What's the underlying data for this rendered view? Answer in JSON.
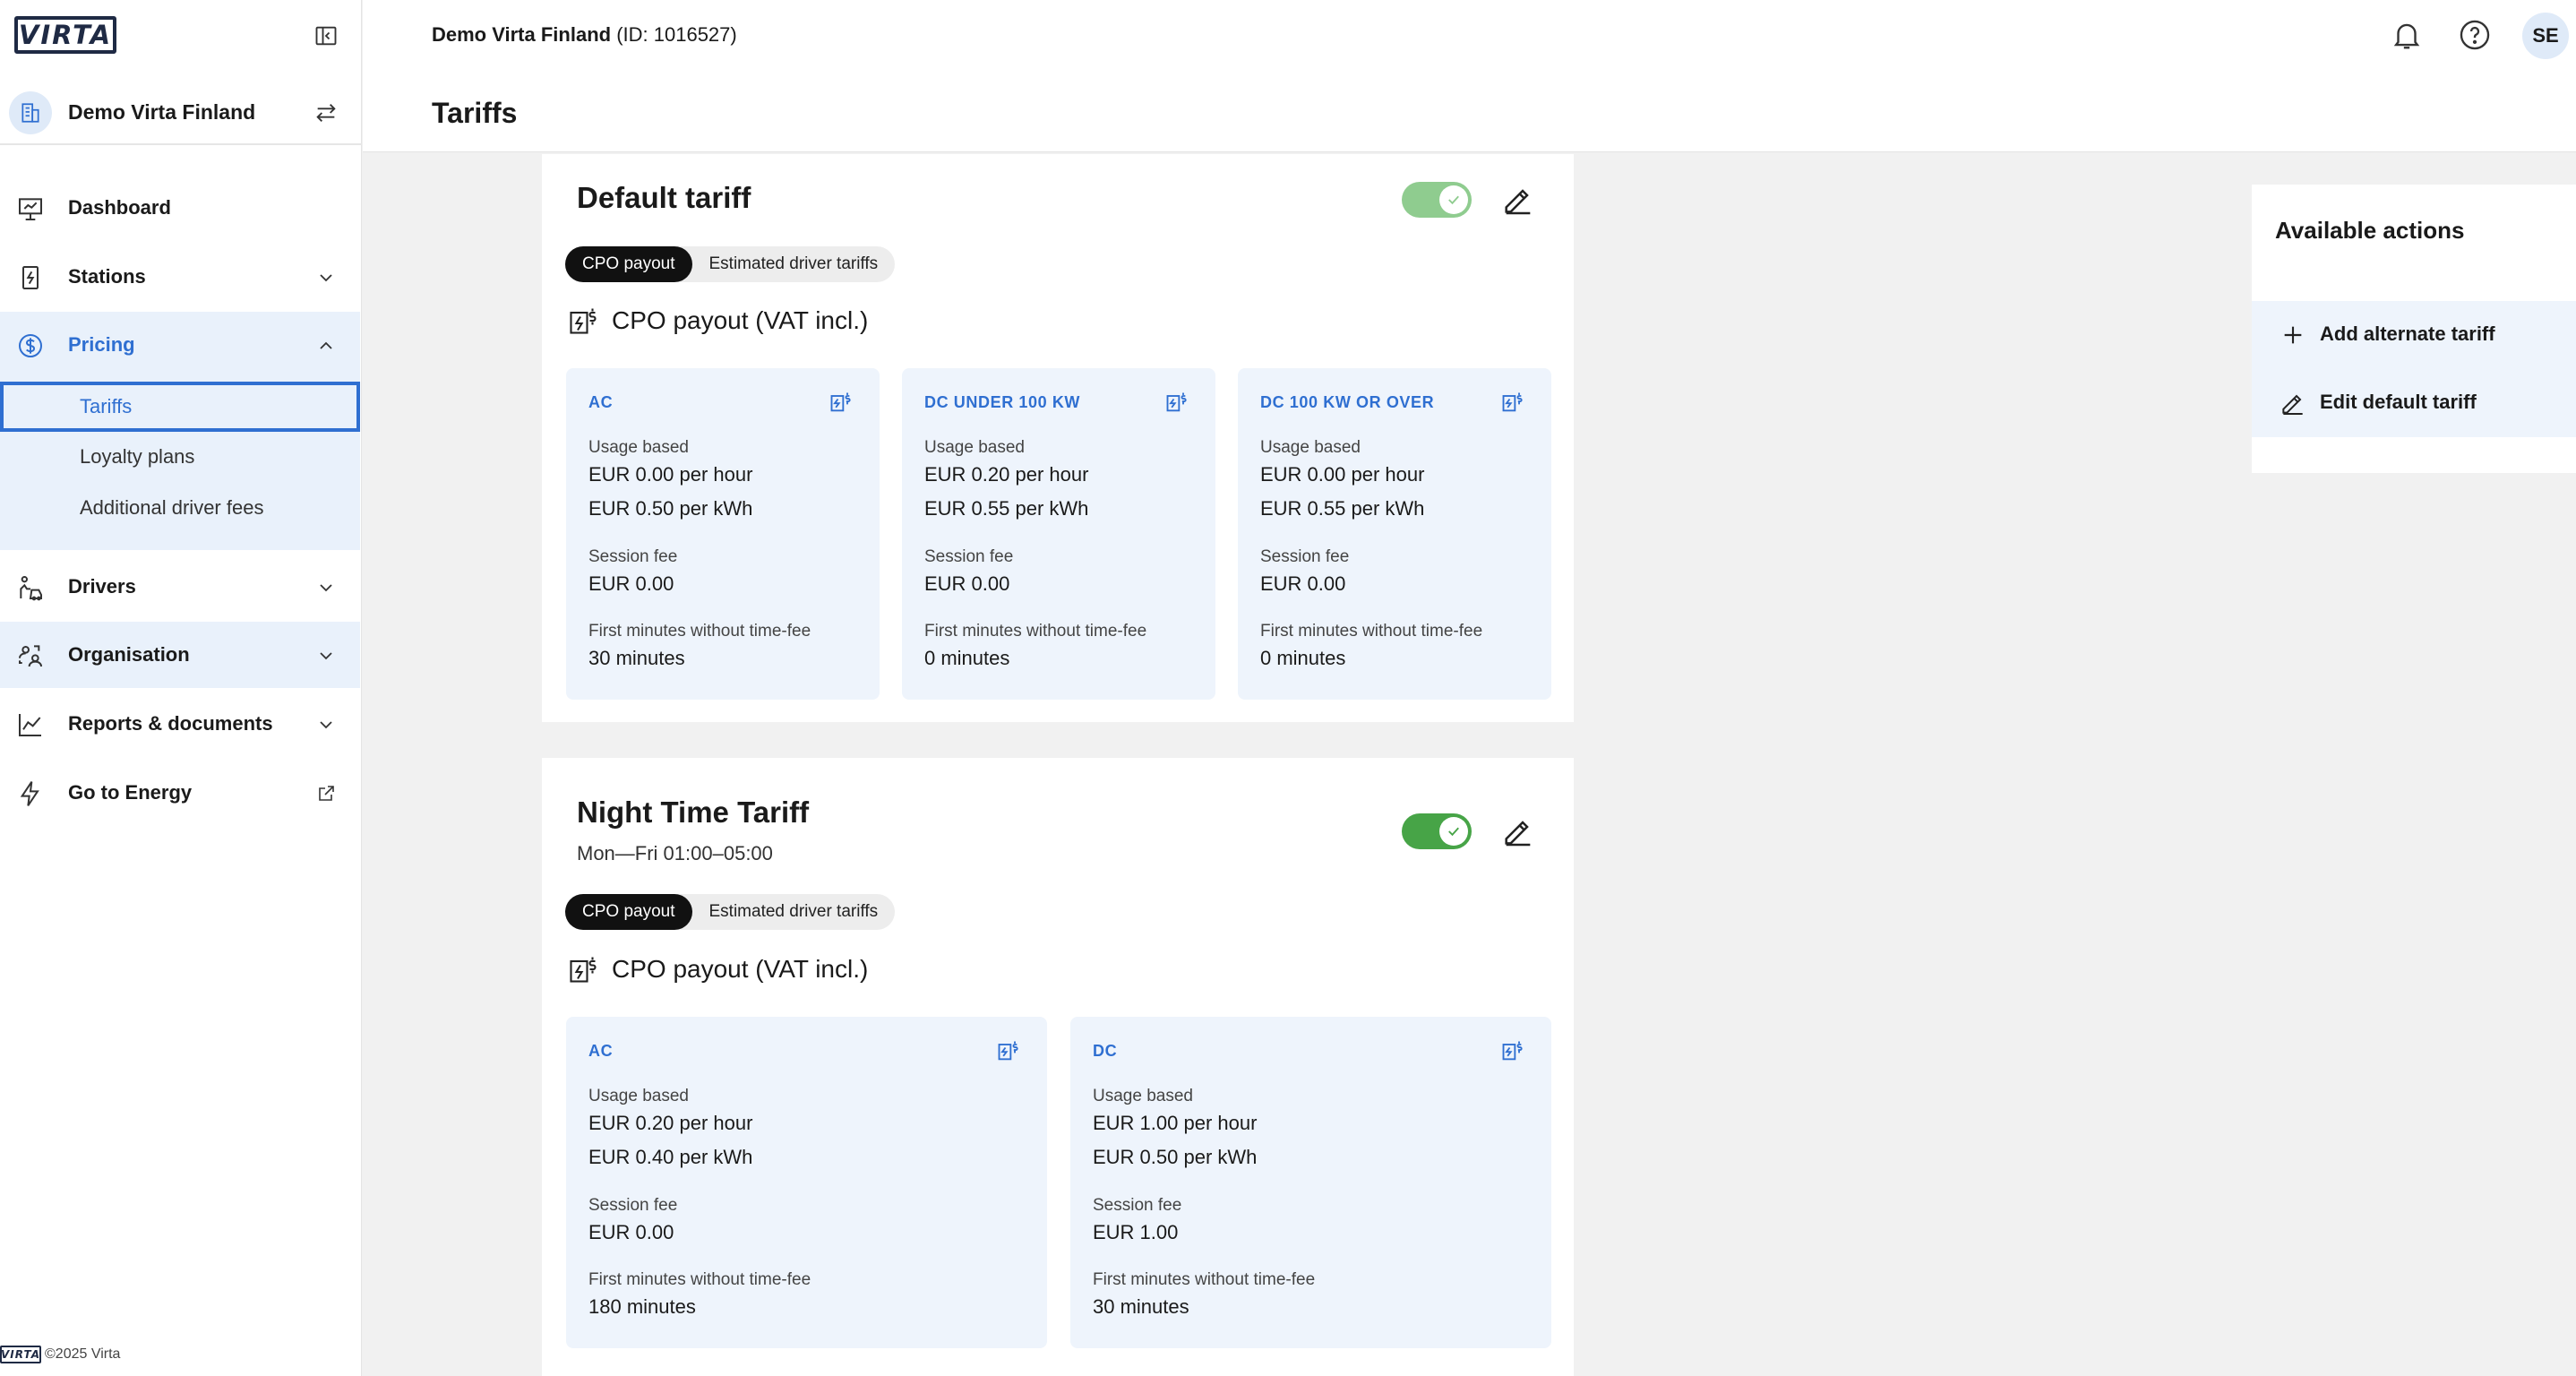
{
  "brand": {
    "logo_text": "VIRTA",
    "accent": "#2f6fd1",
    "toggle_on": "#47a447",
    "toggle_dim": "#8fcc8f"
  },
  "sidebar": {
    "org_name": "Demo Virta Finland",
    "nav": [
      {
        "label": "Dashboard"
      },
      {
        "label": "Stations"
      },
      {
        "label": "Pricing"
      },
      {
        "label": "Drivers"
      },
      {
        "label": "Organisation"
      },
      {
        "label": "Reports & documents"
      },
      {
        "label": "Go to Energy"
      }
    ],
    "pricing_sub": [
      {
        "label": "Tariffs"
      },
      {
        "label": "Loyalty plans"
      },
      {
        "label": "Additional driver fees"
      }
    ],
    "footer": "©2025 Virta"
  },
  "header": {
    "org_name": "Demo Virta Finland",
    "org_id": "(ID: 1016527)",
    "page_title": "Tariffs",
    "user_initials": "SE"
  },
  "tabs": {
    "cpo": "CPO payout",
    "driver": "Estimated driver tariffs"
  },
  "section_title": "CPO payout (VAT incl.)",
  "labels": {
    "usage": "Usage based",
    "session": "Session fee",
    "first": "First minutes without time-fee"
  },
  "tariffs": [
    {
      "name": "Default tariff",
      "enabled": true,
      "cards": [
        {
          "title": "AC",
          "per_hour": "EUR 0.00 per hour",
          "per_kwh": "EUR 0.50 per kWh",
          "session_fee": "EUR 0.00",
          "first_minutes": "30 minutes"
        },
        {
          "title": "DC UNDER 100 KW",
          "per_hour": "EUR 0.20 per hour",
          "per_kwh": "EUR 0.55 per kWh",
          "session_fee": "EUR 0.00",
          "first_minutes": "0 minutes"
        },
        {
          "title": "DC 100 KW OR OVER",
          "per_hour": "EUR 0.00 per hour",
          "per_kwh": "EUR 0.55 per kWh",
          "session_fee": "EUR 0.00",
          "first_minutes": "0 minutes"
        }
      ]
    },
    {
      "name": "Night Time Tariff",
      "schedule": "Mon—Fri 01:00–05:00",
      "enabled": true,
      "cards": [
        {
          "title": "AC",
          "per_hour": "EUR 0.20 per hour",
          "per_kwh": "EUR 0.40 per kWh",
          "session_fee": "EUR 0.00",
          "first_minutes": "180 minutes"
        },
        {
          "title": "DC",
          "per_hour": "EUR 1.00 per hour",
          "per_kwh": "EUR 0.50 per kWh",
          "session_fee": "EUR 1.00",
          "first_minutes": "30 minutes"
        }
      ]
    }
  ],
  "actions": {
    "title": "Available actions",
    "items": [
      {
        "label": "Add alternate tariff"
      },
      {
        "label": "Edit default tariff"
      }
    ]
  }
}
